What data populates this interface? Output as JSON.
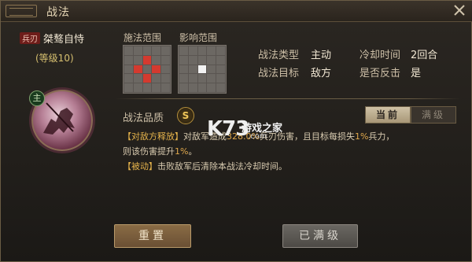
{
  "window": {
    "title": "战法"
  },
  "general": {
    "type_tag": "兵刃",
    "skill_name": "桀骜自恃",
    "level": "(等级10)",
    "faction_char": "主"
  },
  "ranges": {
    "cast_label": "施法范围",
    "effect_label": "影响范围",
    "cast_grid": [
      [
        "",
        "",
        "",
        "",
        ""
      ],
      [
        "",
        "",
        "red",
        "",
        ""
      ],
      [
        "",
        "red",
        "",
        "red",
        ""
      ],
      [
        "",
        "",
        "red",
        "",
        ""
      ],
      [
        "",
        "",
        "",
        "",
        ""
      ]
    ],
    "effect_grid": [
      [
        "",
        "",
        "",
        "",
        ""
      ],
      [
        "",
        "",
        "",
        "",
        ""
      ],
      [
        "",
        "",
        "white",
        "",
        ""
      ],
      [
        "",
        "",
        "",
        "",
        ""
      ],
      [
        "",
        "",
        "",
        "",
        ""
      ]
    ]
  },
  "stats": {
    "type_label": "战法类型",
    "type_value": "主动",
    "cooldown_label": "冷却时间",
    "cooldown_value": "2回合",
    "target_label": "战法目标",
    "target_value": "敌方",
    "counter_label": "是否反击",
    "counter_value": "是"
  },
  "quality": {
    "label": "战法品质",
    "grade": "S"
  },
  "tabs": [
    {
      "label": "当前",
      "active": true
    },
    {
      "label": "满级",
      "active": false
    }
  ],
  "description": {
    "line1_tag": "【对敌方释放】",
    "line1_a": "对敌军造成",
    "line1_pct": "328.0%",
    "line1_b": "兵刃伤害，且目标每损失",
    "line1_pct2": "1%",
    "line1_c": "兵力，",
    "line2_a": "则该伤害提升",
    "line2_pct": "1%",
    "line2_b": "。",
    "line3_tag": "【被动】",
    "line3_text": "击败敌军后清除本战法冷却时间。"
  },
  "watermark": {
    "logo": "K73",
    "cn": "游戏之家",
    "com": ".com"
  },
  "buttons": {
    "reset": "重置",
    "maxed": "已满级"
  },
  "colors": {
    "accent_gold": "#e4b24b",
    "tag_red": "#6e1d1a",
    "range_red": "#d43a2f"
  }
}
